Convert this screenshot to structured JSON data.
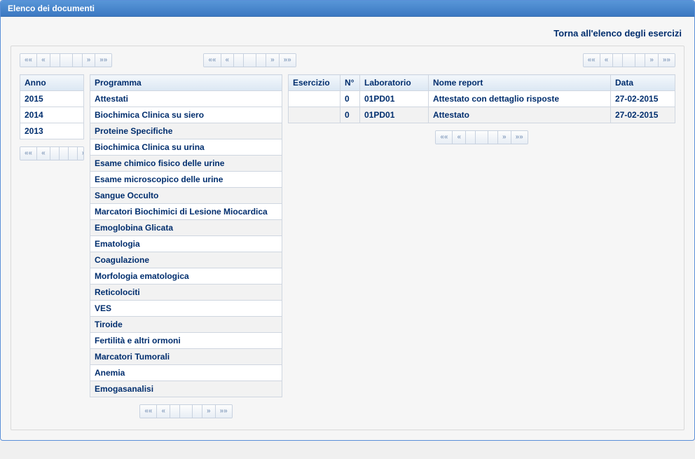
{
  "panel": {
    "title": "Elenco dei documenti"
  },
  "topLink": "Torna all'elenco degli esercizi",
  "headers": {
    "anno": "Anno",
    "programma": "Programma",
    "esercizio": "Esercizio",
    "n": "N°",
    "laboratorio": "Laboratorio",
    "nomeReport": "Nome report",
    "data": "Data"
  },
  "years": [
    {
      "label": "2015",
      "selected": false
    },
    {
      "label": "2014",
      "selected": true
    },
    {
      "label": "2013",
      "selected": false
    }
  ],
  "programs": [
    {
      "label": "Attestati",
      "selected": true
    },
    {
      "label": "Biochimica Clinica su siero"
    },
    {
      "label": "Proteine Specifiche"
    },
    {
      "label": "Biochimica Clinica su urina"
    },
    {
      "label": "Esame chimico fisico delle urine"
    },
    {
      "label": "Esame microscopico delle urine"
    },
    {
      "label": "Sangue Occulto"
    },
    {
      "label": "Marcatori Biochimici di Lesione Miocardica"
    },
    {
      "label": "Emoglobina Glicata"
    },
    {
      "label": "Ematologia"
    },
    {
      "label": "Coagulazione"
    },
    {
      "label": "Morfologia ematologica"
    },
    {
      "label": "Reticolociti"
    },
    {
      "label": "VES"
    },
    {
      "label": "Tiroide"
    },
    {
      "label": "Fertilità e altri ormoni"
    },
    {
      "label": "Marcatori Tumorali"
    },
    {
      "label": "Anemia"
    },
    {
      "label": "Emogasanalisi"
    }
  ],
  "reports": [
    {
      "esercizio": "",
      "n": "0",
      "lab": "01PD01",
      "nome": "Attestato con dettaglio risposte",
      "data": "27-02-2015"
    },
    {
      "esercizio": "",
      "n": "0",
      "lab": "01PD01",
      "nome": "Attestato",
      "data": "27-02-2015"
    }
  ],
  "pager": {
    "first": "««",
    "prev": "«",
    "next": "»",
    "last": "»»"
  }
}
